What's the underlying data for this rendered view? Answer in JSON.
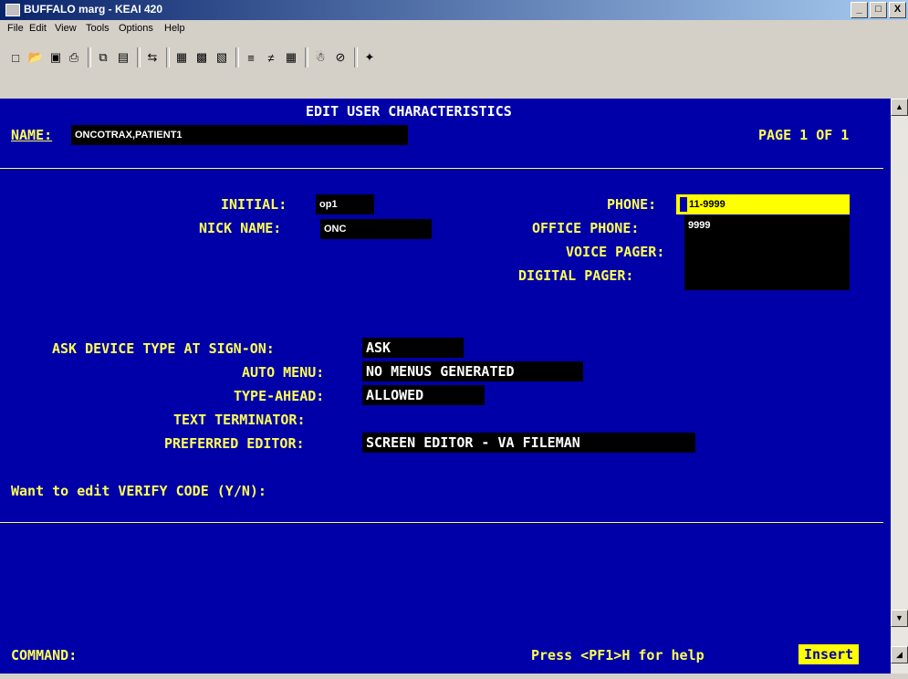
{
  "window": {
    "title": "BUFFALO marg - KEAI 420",
    "controls": [
      "_",
      "□",
      "X"
    ]
  },
  "menu": [
    "File",
    "Edit",
    "View",
    "Tools",
    "Options",
    "Help"
  ],
  "toolbar_icons": [
    "new-icon",
    "open-icon",
    "save-icon",
    "print-icon",
    "copy-icon",
    "paste-icon",
    "send-icon",
    "screen-icon",
    "screen2-icon",
    "screen3-icon",
    "filter-icon",
    "filter2-icon",
    "grid-icon",
    "macro-icon",
    "stop-icon",
    "gear-icon"
  ],
  "screen": {
    "title": "EDIT USER CHARACTERISTICS",
    "name_label": "NAME:",
    "name_value": "ONCOTRAX,PATIENT1",
    "page": "PAGE 1 OF 1",
    "initial_label": "INITIAL:",
    "initial_value": "op1",
    "nick_label": "NICK NAME:",
    "nick_value": "ONC",
    "phone_label": "PHONE:",
    "phone_value": "11-9999",
    "office_phone_label": "OFFICE PHONE:",
    "office_phone_value": "9999",
    "voice_pager_label": "VOICE PAGER:",
    "voice_pager_value": "",
    "digital_pager_label": "DIGITAL PAGER:",
    "digital_pager_value": "",
    "ask_device_label": "ASK DEVICE TYPE AT SIGN-ON:",
    "ask_device_value": "ASK",
    "auto_menu_label": "AUTO MENU:",
    "auto_menu_value": "NO MENUS GENERATED",
    "type_ahead_label": "TYPE-AHEAD:",
    "type_ahead_value": "ALLOWED",
    "text_terminator_label": "TEXT TERMINATOR:",
    "text_terminator_value": "",
    "preferred_editor_label": "PREFERRED EDITOR:",
    "preferred_editor_value": "SCREEN EDITOR - VA FILEMAN",
    "verify_prompt": "Want to edit VERIFY CODE (Y/N):",
    "command_label": "COMMAND:",
    "help_text": "Press <PF1>H for help",
    "insert_label": "Insert"
  }
}
